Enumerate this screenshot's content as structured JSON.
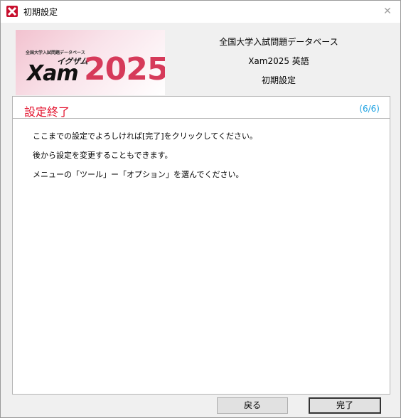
{
  "window": {
    "title": "初期設定",
    "close_glyph": "✕"
  },
  "banner": {
    "top_text": "全国大学入試問題データベース",
    "kana": "イグザム",
    "xam": "Xam",
    "year": "2025"
  },
  "header": {
    "line1": "全国大学入試問題データベース",
    "line2": "Xam2025 英語",
    "line3": "初期設定"
  },
  "panel": {
    "title": "設定終了",
    "step": "(6/6)",
    "lines": [
      "ここまでの設定でよろしければ[完了]をクリックしてください。",
      "後から設定を変更することもできます。",
      "メニューの「ツール」ー「オプション」を選んでください。"
    ]
  },
  "buttons": {
    "back": "戻る",
    "finish": "完了"
  },
  "colors": {
    "accent_red": "#e3112c",
    "step_blue": "#1ba1e2",
    "logo_pink": "#d63a5a"
  },
  "icons": {
    "app": "xam-app-icon",
    "close": "close-icon"
  }
}
